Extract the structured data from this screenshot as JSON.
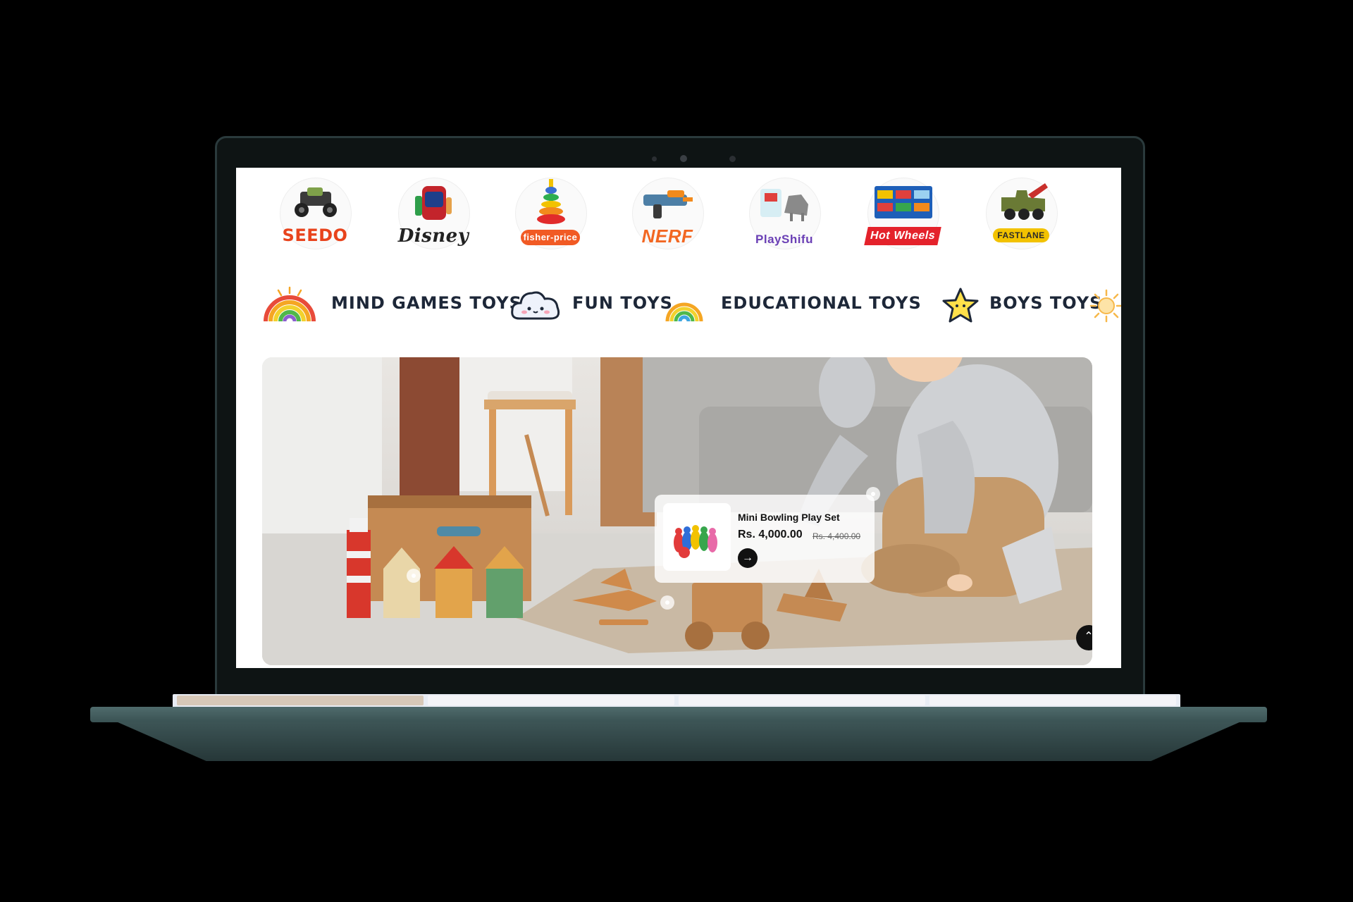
{
  "brands": [
    {
      "name": "SEEDO",
      "color": "#e8431c"
    },
    {
      "name": "Disney",
      "color": "#222222"
    },
    {
      "name": "fisher-price",
      "color": "#f15a24"
    },
    {
      "name": "NERF",
      "color": "#f26722"
    },
    {
      "name": "PlayShifu",
      "color": "#6a3fb5"
    },
    {
      "name": "Hot Wheels",
      "color": "#e4222b"
    },
    {
      "name": "FASTLANE",
      "color": "#2b2b2b"
    }
  ],
  "categories": [
    {
      "label": "MIND GAMES TOYS",
      "icon": "rainbow-icon"
    },
    {
      "label": "FUN TOYS",
      "icon": "cloud-icon"
    },
    {
      "label": "EDUCATIONAL TOYS",
      "icon": "rainbow-icon"
    },
    {
      "label": "BOYS TOYS",
      "icon": "star-icon"
    },
    {
      "label": "",
      "icon": "sun-icon"
    }
  ],
  "hero": {
    "product": {
      "name": "Mini Bowling Play Set",
      "price": "Rs. 4,000.00",
      "old_price": "Rs. 4,400.00"
    }
  },
  "icons": {
    "card_arrow": "→",
    "scroll_top": "⌃"
  }
}
